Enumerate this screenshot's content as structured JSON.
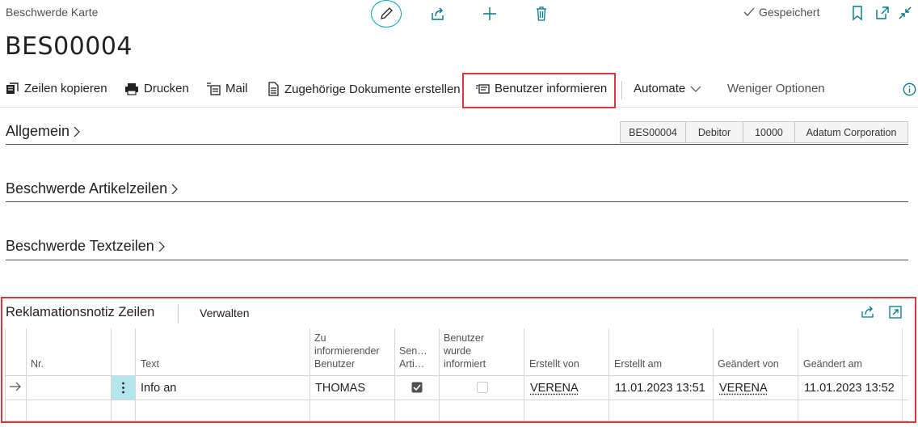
{
  "header": {
    "caption": "Beschwerde Karte",
    "document_no": "BES00004",
    "status": "Gespeichert"
  },
  "actions": {
    "copy_lines": "Zeilen kopieren",
    "print": "Drucken",
    "mail": "Mail",
    "create_docs": "Zugehörige Dokumente erstellen",
    "inform_user": "Benutzer informieren",
    "automate": "Automate",
    "fewer_options": "Weniger Optionen"
  },
  "sections": {
    "general": "Allgemein",
    "item_lines": "Beschwerde Artikelzeilen",
    "text_lines": "Beschwerde Textzeilen"
  },
  "tags": [
    "BES00004",
    "Debitor",
    "10000",
    "Adatum Corporation"
  ],
  "subpage": {
    "title": "Reklamationsnotiz Zeilen",
    "manage": "Verwalten",
    "columns": {
      "no": "Nr.",
      "text": "Text",
      "user_to_inform_1": "Zu",
      "user_to_inform_2": "informierender",
      "user_to_inform_3": "Benutzer",
      "send_1": "Sen…",
      "send_2": "Arti…",
      "user_informed_1": "Benutzer",
      "user_informed_2": "wurde",
      "user_informed_3": "informiert",
      "created_by": "Erstellt von",
      "created_at": "Erstellt am",
      "modified_by": "Geändert von",
      "modified_at": "Geändert am"
    },
    "row": {
      "no": "",
      "text": "Info an",
      "user": "THOMAS",
      "send_checked": true,
      "informed_checked": false,
      "created_by": "VERENA",
      "created_at": "11.01.2023 13:51",
      "modified_by": "VERENA",
      "modified_at": "11.01.2023 13:52"
    }
  },
  "colors": {
    "accent": "#00a0b0",
    "highlight": "#d9383a",
    "selected_cell": "#b3e5ec"
  }
}
